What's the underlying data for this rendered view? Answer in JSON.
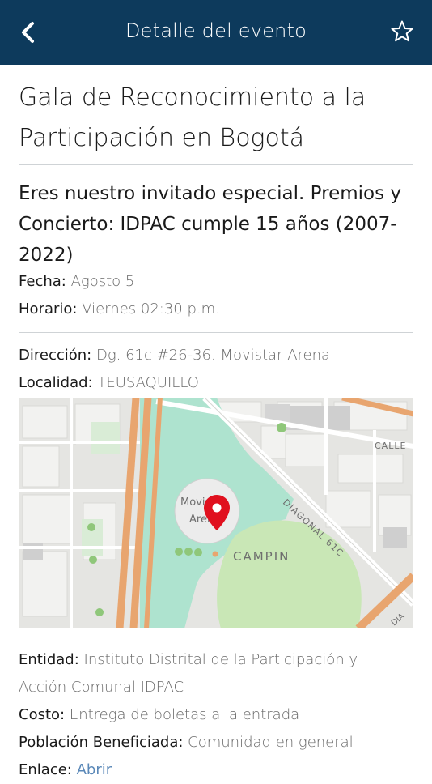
{
  "header": {
    "title": "Detalle del evento",
    "back_icon": "chevron-left-icon",
    "favorite_icon": "star-outline-icon",
    "background": "#0d3a5c"
  },
  "event": {
    "title": "Gala de Reconocimiento a la Participación en Bogotá",
    "description": "Eres nuestro invitado especial. Premios y Concierto: IDPAC cumple 15 años (2007-2022)",
    "date_label": "Fecha:",
    "date_value": "Agosto 5",
    "time_label": "Horario:",
    "time_value": "Viernes 02:30 p.m.",
    "address_label": "Dirección:",
    "address_value": "Dg. 61c #26-36. Movistar Arena",
    "locality_label": "Localidad:",
    "locality_value": "TEUSAQUILLO"
  },
  "map": {
    "labels": {
      "venue_line1": "Movistar",
      "venue_line2": "Arena",
      "park": "CAMPIN",
      "diagonal": "DIAGONAL 61C",
      "calle": "CALLE",
      "corner": "DIA"
    },
    "pin_icon": "map-pin-icon",
    "pin_color": "#e0101e"
  },
  "details": {
    "entity_label": "Entidad:",
    "entity_value": "Instituto Distrital de la Participación y Acción Comunal IDPAC",
    "cost_label": "Costo:",
    "cost_value": "Entrega de boletas a la entrada",
    "population_label": "Población Beneficiada:",
    "population_value": "Comunidad en general",
    "link_label": "Enlace:",
    "link_value": "Abrir"
  }
}
